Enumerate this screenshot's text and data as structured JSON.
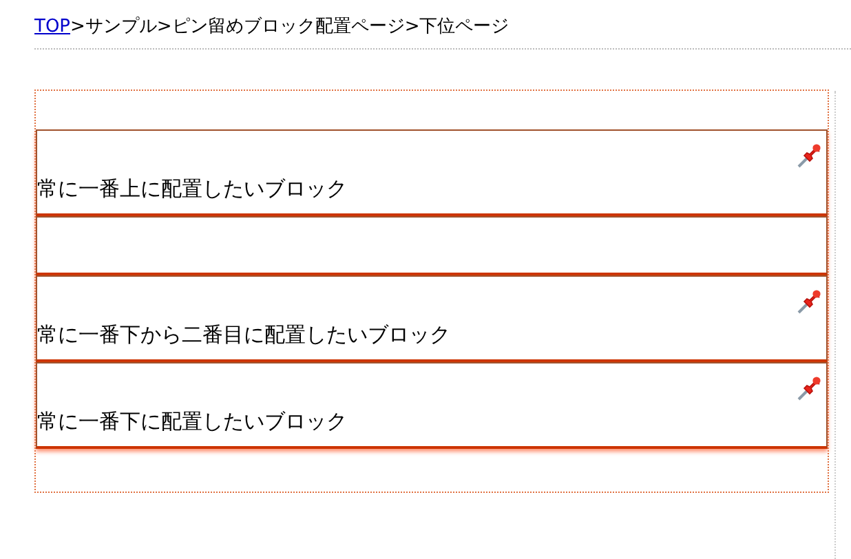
{
  "breadcrumb": [
    {
      "kind": "link",
      "text": "TOP"
    },
    {
      "kind": "separator",
      "text": ">"
    },
    {
      "kind": "crumb",
      "text": "サンプル"
    },
    {
      "kind": "separator",
      "text": ">"
    },
    {
      "kind": "crumb",
      "text": "ピン留めブロック配置ページ"
    },
    {
      "kind": "separator",
      "text": ">"
    },
    {
      "kind": "crumb",
      "text": "下位ページ"
    }
  ],
  "blocks": [
    {
      "pinned": true,
      "text": "常に一番上に配置したいブロック"
    },
    {
      "pinned": false
    },
    {
      "pinned": true,
      "text": "常に一番下から二番目に配置したいブロック"
    },
    {
      "pinned": true,
      "text": "常に一番下に配置したいブロック"
    }
  ]
}
